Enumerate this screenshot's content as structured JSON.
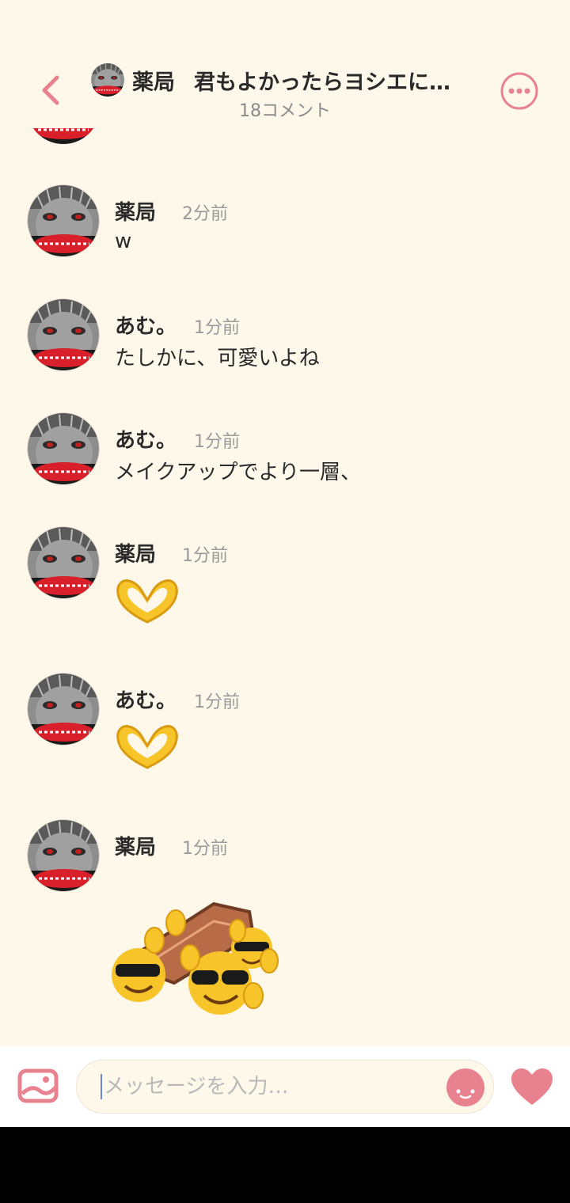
{
  "header": {
    "name": "薬局",
    "title": "君もよかったらヨシエに…",
    "subtitle": "18コメント"
  },
  "messages": [
    {
      "name": "薬局",
      "time": "2分前",
      "text": "w"
    },
    {
      "name": "あむ。",
      "time": "1分前",
      "text": "たしかに、可愛いよね"
    },
    {
      "name": "あむ。",
      "time": "1分前",
      "text": "メイクアップでより一層、"
    },
    {
      "name": "薬局",
      "time": "1分前",
      "sticker": "heart-hands"
    },
    {
      "name": "あむ。",
      "time": "1分前",
      "sticker": "heart-hands"
    },
    {
      "name": "薬局",
      "time": "1分前",
      "sticker": "coffin-dance-sunglasses"
    }
  ],
  "composer": {
    "placeholder": "メッセージを入力…"
  },
  "colors": {
    "background": "#fdf8ea",
    "accent_pink": "#e9828f",
    "text": "#2a2a2a",
    "muted": "#9a9a9a"
  }
}
